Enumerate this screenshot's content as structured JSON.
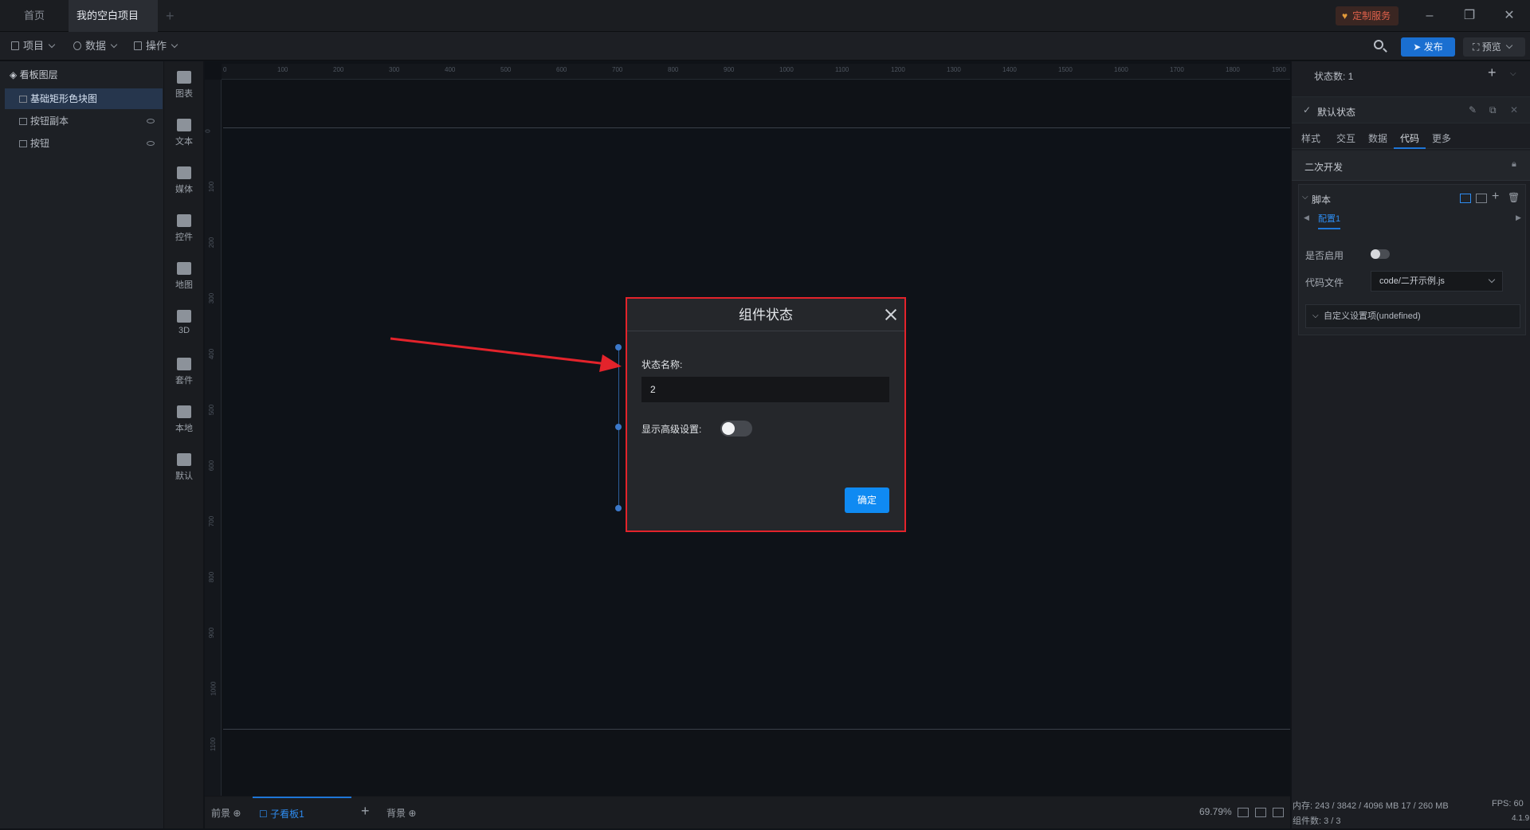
{
  "tabs": {
    "home": "首页",
    "project": "我的空白项目"
  },
  "service_label": "定制服务",
  "toolbar": {
    "project": "项目",
    "data": "数据",
    "operate": "操作",
    "publish": "发布",
    "preview": "预览"
  },
  "layers": {
    "title": "看板图层",
    "items": [
      {
        "label": "基础矩形色块图"
      },
      {
        "label": "按钮副本"
      },
      {
        "label": "按钮"
      }
    ]
  },
  "components": [
    {
      "label": "图表"
    },
    {
      "label": "文本"
    },
    {
      "label": "媒体"
    },
    {
      "label": "控件"
    },
    {
      "label": "地图"
    },
    {
      "label": "3D"
    },
    {
      "label": "套件"
    },
    {
      "label": "本地"
    },
    {
      "label": "默认"
    }
  ],
  "ruler": {
    "top_ticks": [
      "0",
      "100",
      "200",
      "300",
      "400",
      "500",
      "600",
      "700",
      "800",
      "900",
      "1000",
      "1100",
      "1200",
      "1300",
      "1400",
      "1500",
      "1600",
      "1700",
      "1800",
      "1900"
    ],
    "left_ticks": [
      "0",
      "100",
      "200",
      "300",
      "400",
      "500",
      "600",
      "700",
      "800",
      "900",
      "1000",
      "1100"
    ]
  },
  "dialog": {
    "title": "组件状态",
    "state_name_label": "状态名称:",
    "state_name_value": "2",
    "advanced_label": "显示高级设置:",
    "advanced_on": false,
    "ok_label": "确定"
  },
  "bottom": {
    "foreground": "前景",
    "sub_board": "子看板1",
    "background": "背景",
    "zoom": "69.79%"
  },
  "right": {
    "state_count": "状态数:  1",
    "default_state": "默认状态",
    "tabs": [
      "样式",
      "交互",
      "数据",
      "代码",
      "更多"
    ],
    "secondary_dev": "二次开发",
    "script_title": "脚本",
    "config_tab": "配置1",
    "enable_label": "是否启用",
    "code_file_label": "代码文件",
    "code_file_value": "code/二开示例.js",
    "custom_settings": "自定义设置项(undefined)"
  },
  "status": {
    "memory": "内存:  243 / 3842 / 4096 MB  17 / 260 MB",
    "components": "组件数: 3 / 3",
    "fps": "FPS:  60",
    "version": "4.1.9"
  },
  "colors": {
    "accent": "#1e76d8",
    "highlight_border": "#e3232b",
    "ok_button": "#0f8af2"
  }
}
